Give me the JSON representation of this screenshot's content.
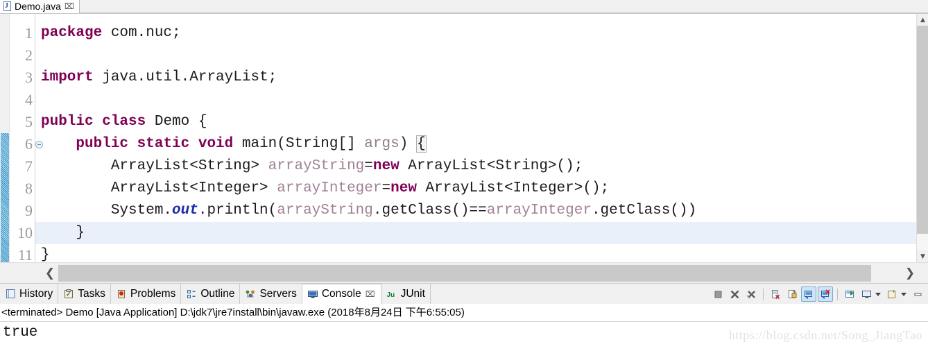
{
  "editor": {
    "tab": {
      "label": "Demo.java",
      "icon": "java-file-icon",
      "close": "⌧",
      "letter": "J"
    },
    "current_line": 10,
    "change_bar_from_line": 6,
    "change_bar_to_line": 11,
    "fold_marker_line": 6,
    "line_numbers": [
      "1",
      "2",
      "3",
      "4",
      "5",
      "6",
      "7",
      "8",
      "9",
      "10",
      "11"
    ],
    "lines": [
      {
        "n": "1",
        "tokens": [
          {
            "t": "package",
            "c": "kw"
          },
          {
            "t": " com.nuc;",
            "c": "plain"
          }
        ]
      },
      {
        "n": "2",
        "tokens": [
          {
            "t": "",
            "c": "plain"
          }
        ]
      },
      {
        "n": "3",
        "tokens": [
          {
            "t": "import",
            "c": "kw"
          },
          {
            "t": " java.util.ArrayList;",
            "c": "plain"
          }
        ]
      },
      {
        "n": "4",
        "tokens": [
          {
            "t": "",
            "c": "plain"
          }
        ]
      },
      {
        "n": "5",
        "tokens": [
          {
            "t": "public class",
            "c": "kw"
          },
          {
            "t": " Demo {",
            "c": "plain"
          }
        ]
      },
      {
        "n": "6",
        "tokens": [
          {
            "t": "    ",
            "c": "plain"
          },
          {
            "t": "public static void",
            "c": "kw"
          },
          {
            "t": " main(String[] ",
            "c": "plain"
          },
          {
            "t": "args",
            "c": "param"
          },
          {
            "t": ") ",
            "c": "plain"
          },
          {
            "t": "{",
            "c": "brmatch"
          }
        ]
      },
      {
        "n": "7",
        "tokens": [
          {
            "t": "        ArrayList<String> ",
            "c": "plain"
          },
          {
            "t": "arrayString",
            "c": "local"
          },
          {
            "t": "=",
            "c": "plain"
          },
          {
            "t": "new",
            "c": "kw"
          },
          {
            "t": " ArrayList<String>();",
            "c": "plain"
          }
        ]
      },
      {
        "n": "8",
        "tokens": [
          {
            "t": "        ArrayList<Integer> ",
            "c": "plain"
          },
          {
            "t": "arrayInteger",
            "c": "local"
          },
          {
            "t": "=",
            "c": "plain"
          },
          {
            "t": "new",
            "c": "kw"
          },
          {
            "t": " ArrayList<Integer>();",
            "c": "plain"
          }
        ]
      },
      {
        "n": "9",
        "tokens": [
          {
            "t": "        System.",
            "c": "plain"
          },
          {
            "t": "out",
            "c": "sfield"
          },
          {
            "t": ".println(",
            "c": "plain"
          },
          {
            "t": "arrayString",
            "c": "local"
          },
          {
            "t": ".getClass()==",
            "c": "plain"
          },
          {
            "t": "arrayInteger",
            "c": "local"
          },
          {
            "t": ".getClass())",
            "c": "plain"
          }
        ]
      },
      {
        "n": "10",
        "tokens": [
          {
            "t": "    }",
            "c": "plain"
          }
        ]
      },
      {
        "n": "11",
        "tokens": [
          {
            "t": "}",
            "c": "plain"
          }
        ]
      }
    ]
  },
  "scrollbars": {
    "h_left_arrow": "❮",
    "h_right_arrow": "❯",
    "v_up_arrow": "▲",
    "v_down_arrow": "▼"
  },
  "view_tabs": [
    {
      "label": "History",
      "icon": "history-icon",
      "active": false,
      "closable": false
    },
    {
      "label": "Tasks",
      "icon": "tasks-icon",
      "active": false,
      "closable": false
    },
    {
      "label": "Problems",
      "icon": "problems-icon",
      "active": false,
      "closable": false
    },
    {
      "label": "Outline",
      "icon": "outline-icon",
      "active": false,
      "closable": false
    },
    {
      "label": "Servers",
      "icon": "servers-icon",
      "active": false,
      "closable": false
    },
    {
      "label": "Console",
      "icon": "console-icon",
      "active": true,
      "closable": true
    },
    {
      "label": "JUnit",
      "icon": "junit-icon",
      "active": false,
      "closable": false
    }
  ],
  "console_toolbar": [
    {
      "name": "terminate-button",
      "icon": "stop-square-icon"
    },
    {
      "name": "remove-launch-button",
      "icon": "x-icon"
    },
    {
      "name": "remove-all-terminated-button",
      "icon": "x-multiple-icon"
    },
    {
      "name": "separator-1",
      "icon": "separator"
    },
    {
      "name": "clear-console-button",
      "icon": "clear-page-icon"
    },
    {
      "name": "scroll-lock-button",
      "icon": "lock-icon"
    },
    {
      "name": "show-console-on-output-button",
      "icon": "console-out-icon",
      "selected": true
    },
    {
      "name": "show-console-on-error-button",
      "icon": "console-err-icon",
      "selected": true
    },
    {
      "name": "separator-2",
      "icon": "separator"
    },
    {
      "name": "pin-console-button",
      "icon": "pin-console-icon"
    },
    {
      "name": "display-selected-console-button",
      "icon": "display-console-icon"
    },
    {
      "name": "display-selected-console-menu",
      "icon": "chevron-down-icon"
    },
    {
      "name": "open-console-button",
      "icon": "new-console-icon"
    },
    {
      "name": "open-console-menu",
      "icon": "chevron-down-icon"
    },
    {
      "name": "minimize-button",
      "icon": "minimize-icon"
    }
  ],
  "console": {
    "header": "<terminated> Demo [Java Application] D:\\jdk7\\jre7install\\bin\\javaw.exe (2018年8月24日 下午6:55:05)",
    "output": "true",
    "watermark": "https://blog.csdn.net/Song_JiangTao"
  },
  "colors": {
    "keyword": "#7f0055",
    "static_field": "#1a2ba8",
    "local_var": "#a08095",
    "parameter": "#8d7f7f",
    "current_line_bg": "#e9f0fa",
    "change_bar": "#2f8fc4",
    "toolbar_selected_bg": "#cfe4f7"
  }
}
